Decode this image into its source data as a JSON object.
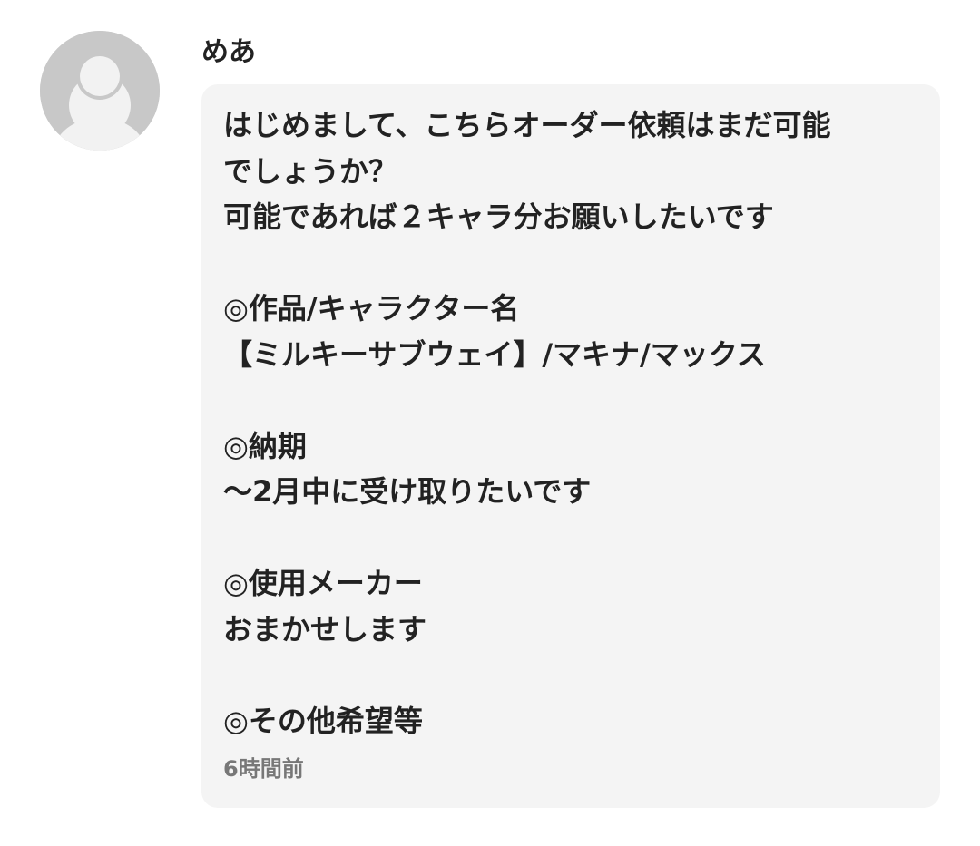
{
  "comment": {
    "username": "めあ",
    "avatar_icon": "default-user-avatar-icon",
    "avatar_bg": "#c8c8c8",
    "avatar_fg": "#f2f2f2",
    "message": "はじめまして、こちらオーダー依頼はまだ可能\nでしょうか？\n可能であれば２キャラ分お願いしたいです\n\n◎作品/キャラクター名\n【ミルキーサブウェイ】/マキナ/マックス\n\n◎納期\n〜2月中に受け取りたいです\n\n◎使用メーカー\nおまかせします\n\n◎その他希望等",
    "timestamp": "6時間前"
  }
}
